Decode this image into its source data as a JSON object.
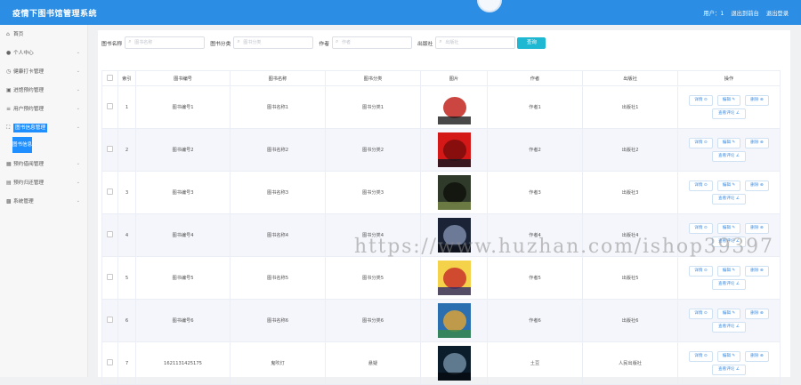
{
  "header": {
    "app_title": "疫情下图书馆管理系统",
    "user_label": "用户：1",
    "back_label": "退出到前台",
    "logout_label": "退出登录"
  },
  "sidebar": {
    "items": [
      {
        "icon": "home-icon",
        "label": "首页",
        "has_chevron": false
      },
      {
        "icon": "user-icon",
        "label": "个人中心",
        "has_chevron": true
      },
      {
        "icon": "clock-icon",
        "label": "健康打卡管理",
        "has_chevron": true
      },
      {
        "icon": "message-icon",
        "label": "进馆预约管理",
        "has_chevron": true
      },
      {
        "icon": "list-icon",
        "label": "用户预约管理",
        "has_chevron": true
      },
      {
        "icon": "expand-icon",
        "label": "图书信息管理",
        "has_chevron": true,
        "active": true,
        "child": "图书信息"
      },
      {
        "icon": "calendar-icon",
        "label": "预约借阅管理",
        "has_chevron": true
      },
      {
        "icon": "clipboard-icon",
        "label": "预约归还管理",
        "has_chevron": true
      },
      {
        "icon": "box-icon",
        "label": "系统管理",
        "has_chevron": true
      }
    ]
  },
  "search": {
    "fields": [
      {
        "label": "图书名称",
        "placeholder": "图书名称"
      },
      {
        "label": "图书分类",
        "placeholder": "图书分类"
      },
      {
        "label": "作者",
        "placeholder": "作者"
      },
      {
        "label": "出版社",
        "placeholder": "出版社"
      }
    ],
    "button_label": "查询"
  },
  "table": {
    "headers": [
      "",
      "索引",
      "图书编号",
      "图书名称",
      "图书分类",
      "图片",
      "作者",
      "出版社",
      "操作"
    ],
    "rows": [
      {
        "index": "1",
        "code": "图书编号1",
        "name": "图书名称1",
        "category": "图书分类1",
        "author": "作者1",
        "publisher": "出版社1",
        "cover": [
          "#ffffff",
          "#c2261f",
          "#1a1a1a"
        ]
      },
      {
        "index": "2",
        "code": "图书编号2",
        "name": "图书名称2",
        "category": "图书分类2",
        "author": "作者2",
        "publisher": "出版社2",
        "cover": [
          "#d41818",
          "#7a0c0c",
          "#101820"
        ]
      },
      {
        "index": "3",
        "code": "图书编号3",
        "name": "图书名称3",
        "category": "图书分类3",
        "author": "作者3",
        "publisher": "出版社3",
        "cover": [
          "#2f3a2a",
          "#0e120c",
          "#7a8a4a"
        ]
      },
      {
        "index": "4",
        "code": "图书编号4",
        "name": "图书名称4",
        "category": "图书分类4",
        "author": "作者4",
        "publisher": "出版社4",
        "cover": [
          "#1b2436",
          "#7b8aa8",
          "#0b0f18"
        ]
      },
      {
        "index": "5",
        "code": "图书编号5",
        "name": "图书名称5",
        "category": "图书分类5",
        "author": "作者5",
        "publisher": "出版社5",
        "cover": [
          "#f4d24a",
          "#c8322a",
          "#2a2a6a"
        ]
      },
      {
        "index": "6",
        "code": "图书编号6",
        "name": "图书名称6",
        "category": "图书分类6",
        "author": "作者6",
        "publisher": "出版社6",
        "cover": [
          "#2b6fb0",
          "#d9a23a",
          "#3a8a4a"
        ]
      },
      {
        "index": "7",
        "code": "1621131425175",
        "name": "鬼吹灯",
        "category": "悬疑",
        "author": "土豆",
        "publisher": "人民出版社",
        "cover": [
          "#0b1c2b",
          "#6f8aa0",
          "#050a10"
        ]
      }
    ],
    "actions": {
      "detail": "详情 ⊙",
      "edit": "编辑 ✎",
      "delete": "删除 ⊗",
      "review": "查看评论 ∠"
    }
  },
  "watermark": "https://www.huzhan.com/ishop39397",
  "colors": {
    "header": "#2b8de3",
    "active": "#1f8fff",
    "search_button": "#1fb8d3"
  }
}
